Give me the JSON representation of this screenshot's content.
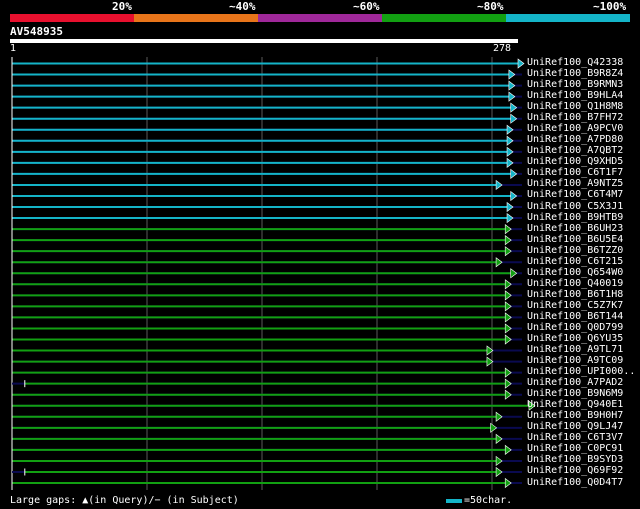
{
  "legend": {
    "labels": [
      "20%",
      "~40%",
      "~60%",
      "~80%",
      "~100%"
    ],
    "colors": [
      "#e8102e",
      "#e8751a",
      "#a0289a",
      "#12a012",
      "#14b4c8"
    ]
  },
  "query": {
    "id": "AV548935",
    "start": "1",
    "end": "278"
  },
  "hits": [
    {
      "name": "UniRef100_Q42338",
      "color": "#14b4c8",
      "start": 1,
      "end": 278,
      "arrow": "right"
    },
    {
      "name": "UniRef100_B9R8Z4",
      "color": "#14b4c8",
      "start": 1,
      "end": 273,
      "arrow": "right"
    },
    {
      "name": "UniRef100_B9RMN3",
      "color": "#14b4c8",
      "start": 1,
      "end": 273,
      "arrow": "right"
    },
    {
      "name": "UniRef100_B9HLA4",
      "color": "#14b4c8",
      "start": 1,
      "end": 273,
      "arrow": "right"
    },
    {
      "name": "UniRef100_Q1H8M8",
      "color": "#14b4c8",
      "start": 1,
      "end": 274,
      "arrow": "right"
    },
    {
      "name": "UniRef100_B7FH72",
      "color": "#14b4c8",
      "start": 1,
      "end": 274,
      "arrow": "right"
    },
    {
      "name": "UniRef100_A9PCV0",
      "color": "#14b4c8",
      "start": 1,
      "end": 272,
      "arrow": "right"
    },
    {
      "name": "UniRef100_A7PD80",
      "color": "#14b4c8",
      "start": 1,
      "end": 272,
      "arrow": "right"
    },
    {
      "name": "UniRef100_A7QBT2",
      "color": "#14b4c8",
      "start": 1,
      "end": 272,
      "arrow": "right"
    },
    {
      "name": "UniRef100_Q9XHD5",
      "color": "#14b4c8",
      "start": 1,
      "end": 272,
      "arrow": "right"
    },
    {
      "name": "UniRef100_C6T1F7",
      "color": "#14b4c8",
      "start": 1,
      "end": 274,
      "arrow": "right"
    },
    {
      "name": "UniRef100_A9NTZ5",
      "color": "#14b4c8",
      "start": 1,
      "end": 266,
      "arrow": "right"
    },
    {
      "name": "UniRef100_C6T4M7",
      "color": "#14b4c8",
      "start": 1,
      "end": 274,
      "arrow": "right"
    },
    {
      "name": "UniRef100_C5X3J1",
      "color": "#14b4c8",
      "start": 1,
      "end": 272,
      "arrow": "right"
    },
    {
      "name": "UniRef100_B9HTB9",
      "color": "#14b4c8",
      "start": 1,
      "end": 272,
      "arrow": "right"
    },
    {
      "name": "UniRef100_B6UH23",
      "color": "#12a012",
      "start": 1,
      "end": 271,
      "arrow": "right"
    },
    {
      "name": "UniRef100_B6U5E4",
      "color": "#12a012",
      "start": 1,
      "end": 271,
      "arrow": "right"
    },
    {
      "name": "UniRef100_B6TZZ0",
      "color": "#12a012",
      "start": 1,
      "end": 271,
      "arrow": "right"
    },
    {
      "name": "UniRef100_C6T215",
      "color": "#12a012",
      "start": 1,
      "end": 266,
      "arrow": "right"
    },
    {
      "name": "UniRef100_Q654W0",
      "color": "#12a012",
      "start": 1,
      "end": 274,
      "arrow": "right"
    },
    {
      "name": "UniRef100_Q40019",
      "color": "#12a012",
      "start": 1,
      "end": 271,
      "arrow": "right"
    },
    {
      "name": "UniRef100_B6T1H8",
      "color": "#12a012",
      "start": 1,
      "end": 271,
      "arrow": "right"
    },
    {
      "name": "UniRef100_C5Z7K7",
      "color": "#12a012",
      "start": 1,
      "end": 271,
      "arrow": "right"
    },
    {
      "name": "UniRef100_B6T144",
      "color": "#12a012",
      "start": 1,
      "end": 271,
      "arrow": "right"
    },
    {
      "name": "UniRef100_Q0D799",
      "color": "#12a012",
      "start": 1,
      "end": 271,
      "arrow": "right"
    },
    {
      "name": "UniRef100_Q6YU35",
      "color": "#12a012",
      "start": 1,
      "end": 271,
      "arrow": "right"
    },
    {
      "name": "UniRef100_A9TL71",
      "color": "#12a012",
      "start": 1,
      "end": 261,
      "arrow": "right"
    },
    {
      "name": "UniRef100_A9TC09",
      "color": "#12a012",
      "start": 1,
      "end": 261,
      "arrow": "right"
    },
    {
      "name": "UniRef100_UPI000..",
      "color": "#12a012",
      "start": 1,
      "end": 271,
      "arrow": "right"
    },
    {
      "name": "UniRef100_A7PAD2",
      "color": "#12a012",
      "start": 8,
      "end": 271,
      "arrow": "right"
    },
    {
      "name": "UniRef100_B9N6M9",
      "color": "#12a012",
      "start": 1,
      "end": 271,
      "arrow": "right"
    },
    {
      "name": "UniRef100_Q940E1",
      "color": "#12a012",
      "start": 1,
      "end": 284,
      "arrow": "right"
    },
    {
      "name": "UniRef100_B9H0H7",
      "color": "#12a012",
      "start": 1,
      "end": 266,
      "arrow": "right"
    },
    {
      "name": "UniRef100_Q9LJ47",
      "color": "#12a012",
      "start": 1,
      "end": 263,
      "arrow": "right"
    },
    {
      "name": "UniRef100_C6T3V7",
      "color": "#12a012",
      "start": 1,
      "end": 266,
      "arrow": "right"
    },
    {
      "name": "UniRef100_C0PC91",
      "color": "#12a012",
      "start": 1,
      "end": 271,
      "arrow": "right"
    },
    {
      "name": "UniRef100_B9SYD3",
      "color": "#12a012",
      "start": 1,
      "end": 266,
      "arrow": "right"
    },
    {
      "name": "UniRef100_Q69F92",
      "color": "#12a012",
      "start": 8,
      "end": 266,
      "arrow": "right"
    },
    {
      "name": "UniRef100_Q0D4T7",
      "color": "#12a012",
      "start": 1,
      "end": 271,
      "arrow": "right"
    }
  ],
  "footer": {
    "text": "Large gaps: ▲(in Query)/− (in Subject)",
    "scale_label": "=50char.",
    "scale_color": "#14b4c8"
  },
  "colors": {
    "grid": "#5a5a5a",
    "dark_track": "#0a0a50",
    "background": "#000000"
  }
}
